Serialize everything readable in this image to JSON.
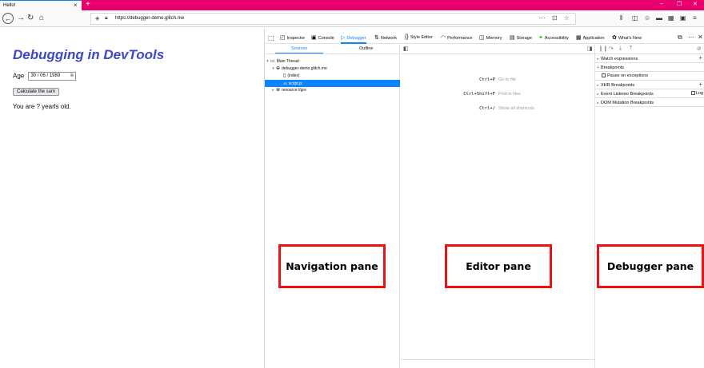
{
  "browser": {
    "tab_title": "Hello!",
    "tab_close": "×",
    "new_tab": "+",
    "url": "https://debugger-demo.glitch.me",
    "window_controls": [
      "–",
      "❐",
      "✕"
    ]
  },
  "page": {
    "heading": "Debugging in DevTools",
    "age_label": "Age",
    "date_value": "30 / 06 / 1989",
    "button_label": "Calculate the sum",
    "result_text": "You are ? yearls old."
  },
  "devtools": {
    "tabs": [
      {
        "icon": "◰",
        "label": "Inspector"
      },
      {
        "icon": "▣",
        "label": "Console"
      },
      {
        "icon": "▷",
        "label": "Debugger"
      },
      {
        "icon": "⇅",
        "label": "Network"
      },
      {
        "icon": "{}",
        "label": "Style Editor"
      },
      {
        "icon": "◠",
        "label": "Performance"
      },
      {
        "icon": "◫",
        "label": "Memory"
      },
      {
        "icon": "▤",
        "label": "Storage"
      },
      {
        "icon": "✦",
        "label": "Accessibility"
      },
      {
        "icon": "▦",
        "label": "Application"
      },
      {
        "icon": "✿",
        "label": "What's New"
      }
    ],
    "active_tab": "Debugger",
    "sources_tab": "Sources",
    "outline_tab": "Outline",
    "tree": [
      {
        "label": "Main Thread",
        "twisty": "▾",
        "icon": "▭"
      },
      {
        "label": "debugger-demo.glitch.me",
        "twisty": "▾",
        "icon": "⊕"
      },
      {
        "label": "(index)",
        "twisty": "",
        "icon": "▯"
      },
      {
        "label": "script.js",
        "twisty": "",
        "icon": "JS"
      },
      {
        "label": "resource://gre",
        "twisty": "▸",
        "icon": "⊕"
      }
    ],
    "shortcuts": [
      {
        "keys": "Ctrl+P",
        "desc": "Go to file"
      },
      {
        "keys": "Ctrl+Shift+F",
        "desc": "Find in files"
      },
      {
        "keys": "Ctrl+/",
        "desc": "Show all shortcuts"
      }
    ],
    "debugger_sections": {
      "watch": "Watch expressions",
      "breakpoints": "Breakpoints",
      "pause_exceptions": "Pause on exceptions",
      "xhr": "XHR Breakpoints",
      "event_listener": "Event Listener Breakpoints",
      "log": "Log",
      "dom_mutation": "DOM Mutation Breakpoints"
    }
  },
  "annotations": {
    "navigation": "Navigation pane",
    "editor": "Editor pane",
    "debugger": "Debugger pane"
  },
  "colors": {
    "tab_strip": "#e8006d",
    "heading": "#3a48c9",
    "accent": "#0a84ff",
    "annotation_border": "#e11111"
  }
}
